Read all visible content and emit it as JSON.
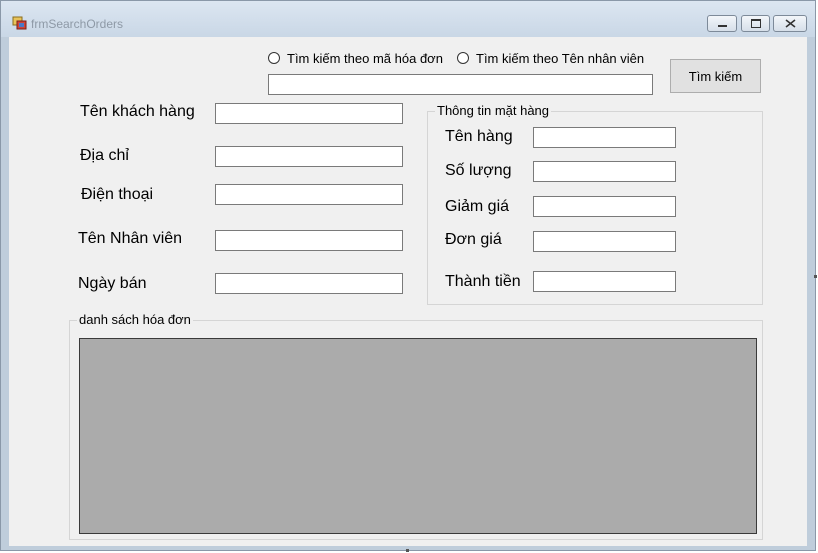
{
  "window": {
    "title": "frmSearchOrders",
    "controls": {
      "minimize": "minimize-icon",
      "maximize": "maximize-icon",
      "close": "close-icon"
    }
  },
  "search": {
    "radio_invoice_label": "Tìm kiếm theo mã hóa đơn",
    "radio_employee_label": "Tìm kiếm theo Tên nhân viên",
    "input_value": "",
    "button_label": "Tìm kiếm"
  },
  "customer": {
    "name_label": "Tên khách hàng",
    "address_label": "Địa chỉ",
    "phone_label": "Điện thoại",
    "employee_label": "Tên Nhân viên",
    "sale_date_label": "Ngày bán",
    "name_value": "",
    "address_value": "",
    "phone_value": "",
    "employee_value": "",
    "sale_date_value": ""
  },
  "item_info": {
    "group_title": "Thông tin mặt hàng",
    "product_name_label": "Tên hàng",
    "quantity_label": "Số lượng",
    "discount_label": "Giảm giá",
    "unit_price_label": "Đơn giá",
    "total_label": "Thành tiền",
    "product_name_value": "",
    "quantity_value": "",
    "discount_value": "",
    "unit_price_value": "",
    "total_value": ""
  },
  "invoice_list": {
    "group_title": "danh sách hóa đơn"
  },
  "colors": {
    "grid_background": "#ababab",
    "form_background": "#f0f0f0",
    "title_bar": "#dce6f1"
  }
}
